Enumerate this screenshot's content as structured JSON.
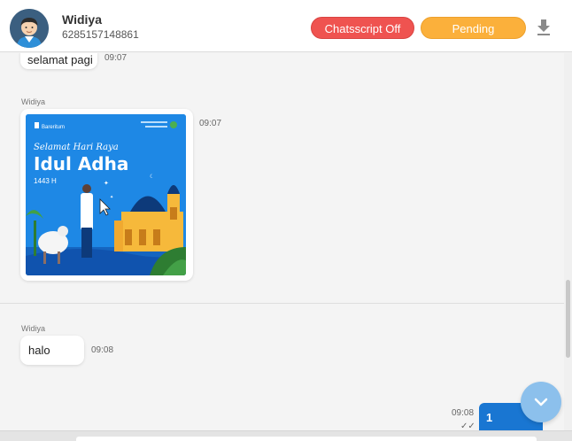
{
  "contact": {
    "name": "Widiya",
    "phone": "6285157148861"
  },
  "header": {
    "chatsscript_label": "Chatsscript Off",
    "pending_label": "Pending",
    "download_icon": "download-icon"
  },
  "messages": [
    {
      "direction": "incoming",
      "text": "selamat pagi",
      "time": "09:07"
    },
    {
      "direction": "incoming",
      "sender": "Widiya",
      "type": "image",
      "time": "09:07",
      "image_text": {
        "brand": "Bareritum",
        "greeting": "Selamat Hari Raya",
        "title": "Idul Adha",
        "year": "1443 H"
      }
    },
    {
      "direction": "incoming",
      "sender": "Widiya",
      "text": "halo",
      "time": "09:08"
    },
    {
      "direction": "outgoing",
      "text": "1",
      "time": "09:08",
      "status": "✓✓"
    }
  ],
  "colors": {
    "chatsscript_button": "#ef5350",
    "pending_button": "#fbb03b",
    "outgoing_bubble": "#1976d2",
    "scroll_fab": "#8cc0ec"
  }
}
